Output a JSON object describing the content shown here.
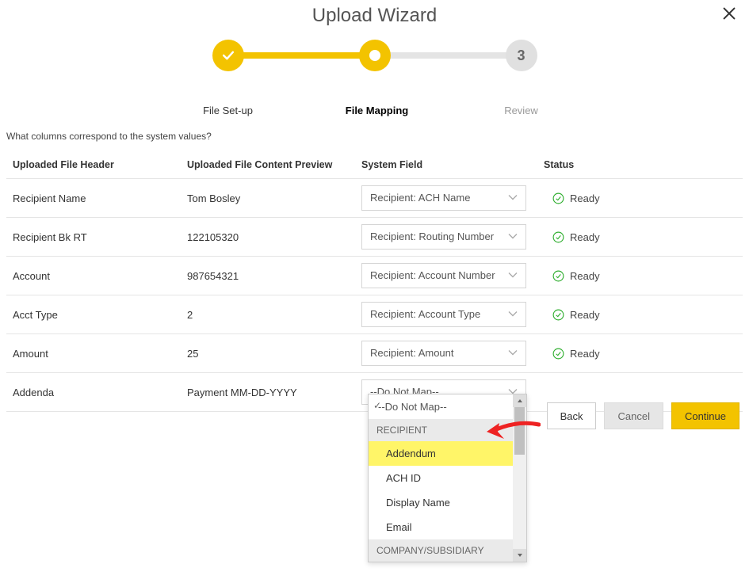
{
  "title": "Upload Wizard",
  "stepper": {
    "step1": "File Set-up",
    "step2": "File Mapping",
    "step3": "Review",
    "step3_num": "3"
  },
  "question": "What columns correspond to the system values?",
  "columns": {
    "c1": "Uploaded File Header",
    "c2": "Uploaded File Content Preview",
    "c3": "System Field",
    "c4": "Status"
  },
  "status_ready": "Ready",
  "rows": [
    {
      "header": "Recipient Name",
      "preview": "Tom Bosley",
      "field": "Recipient: ACH Name"
    },
    {
      "header": "Recipient Bk RT",
      "preview": "122105320",
      "field": "Recipient: Routing Number"
    },
    {
      "header": "Account",
      "preview": "987654321",
      "field": "Recipient: Account Number"
    },
    {
      "header": "Acct Type",
      "preview": "2",
      "field": "Recipient: Account Type"
    },
    {
      "header": "Amount",
      "preview": "25",
      "field": "Recipient: Amount"
    },
    {
      "header": "Addenda",
      "preview": "Payment MM-DD-YYYY",
      "field": "--Do Not Map--"
    }
  ],
  "dropdown": {
    "selected": "--Do Not Map--",
    "group1": "RECIPIENT",
    "opt_addendum": "Addendum",
    "opt_achid": "ACH ID",
    "opt_display": "Display Name",
    "opt_email": "Email",
    "group2": "COMPANY/SUBSIDIARY"
  },
  "buttons": {
    "back": "Back",
    "cancel": "Cancel",
    "continue": "Continue"
  }
}
